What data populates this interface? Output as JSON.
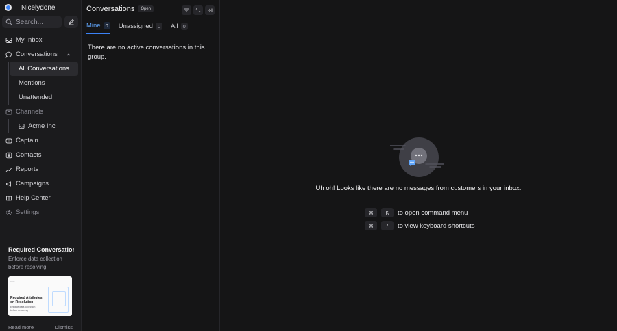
{
  "brand": {
    "name": "Nicelydone"
  },
  "search": {
    "placeholder": "Search..."
  },
  "sidebar": {
    "items": [
      {
        "label": "My Inbox"
      },
      {
        "label": "Conversations"
      },
      {
        "label": "All Conversations"
      },
      {
        "label": "Mentions"
      },
      {
        "label": "Unattended"
      },
      {
        "label": "Channels"
      },
      {
        "label": "Acme Inc"
      },
      {
        "label": "Captain"
      },
      {
        "label": "Contacts"
      },
      {
        "label": "Reports"
      },
      {
        "label": "Campaigns"
      },
      {
        "label": "Help Center"
      },
      {
        "label": "Settings"
      }
    ]
  },
  "promo": {
    "title": "Required Conversation Attributes",
    "description": "Enforce data collection before resolving",
    "card_title": "Required Attributes on Resolution",
    "card_subtitle": "Enforce data collection before resolving",
    "read_more": "Read more",
    "dismiss": "Dismiss"
  },
  "list": {
    "title": "Conversations",
    "status": "Open",
    "tabs": [
      {
        "label": "Mine",
        "count": "0"
      },
      {
        "label": "Unassigned",
        "count": "0"
      },
      {
        "label": "All",
        "count": "0"
      }
    ],
    "empty_text": "There are no active conversations in this group."
  },
  "main": {
    "empty_message": "Uh oh! Looks like there are no messages from customers in your inbox.",
    "shortcuts": [
      {
        "key1": "⌘",
        "key2": "K",
        "label": "to open command menu"
      },
      {
        "key1": "⌘",
        "key2": "/",
        "label": "to view keyboard shortcuts"
      }
    ]
  },
  "colors": {
    "accent": "#3b82f6",
    "background": "#151516",
    "sidebar": "#1b1b1d"
  }
}
